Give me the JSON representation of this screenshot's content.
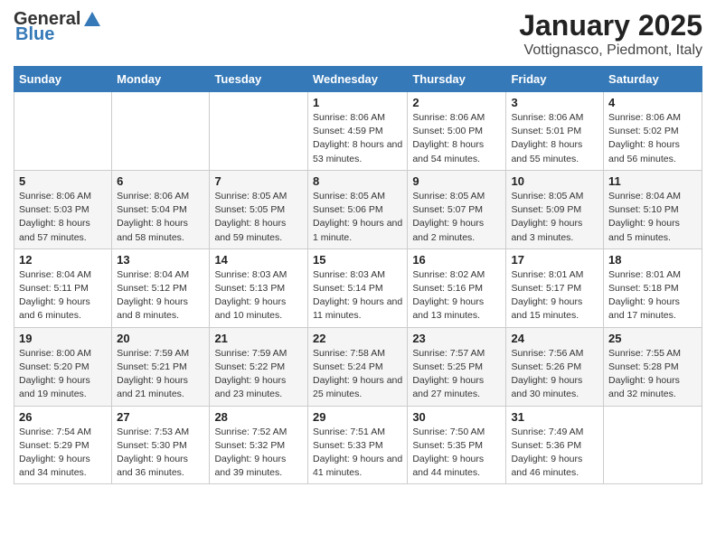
{
  "header": {
    "logo_general": "General",
    "logo_blue": "Blue",
    "title": "January 2025",
    "subtitle": "Vottignasco, Piedmont, Italy"
  },
  "columns": [
    "Sunday",
    "Monday",
    "Tuesday",
    "Wednesday",
    "Thursday",
    "Friday",
    "Saturday"
  ],
  "weeks": [
    [
      {
        "day": "",
        "info": ""
      },
      {
        "day": "",
        "info": ""
      },
      {
        "day": "",
        "info": ""
      },
      {
        "day": "1",
        "info": "Sunrise: 8:06 AM\nSunset: 4:59 PM\nDaylight: 8 hours and 53 minutes."
      },
      {
        "day": "2",
        "info": "Sunrise: 8:06 AM\nSunset: 5:00 PM\nDaylight: 8 hours and 54 minutes."
      },
      {
        "day": "3",
        "info": "Sunrise: 8:06 AM\nSunset: 5:01 PM\nDaylight: 8 hours and 55 minutes."
      },
      {
        "day": "4",
        "info": "Sunrise: 8:06 AM\nSunset: 5:02 PM\nDaylight: 8 hours and 56 minutes."
      }
    ],
    [
      {
        "day": "5",
        "info": "Sunrise: 8:06 AM\nSunset: 5:03 PM\nDaylight: 8 hours and 57 minutes."
      },
      {
        "day": "6",
        "info": "Sunrise: 8:06 AM\nSunset: 5:04 PM\nDaylight: 8 hours and 58 minutes."
      },
      {
        "day": "7",
        "info": "Sunrise: 8:05 AM\nSunset: 5:05 PM\nDaylight: 8 hours and 59 minutes."
      },
      {
        "day": "8",
        "info": "Sunrise: 8:05 AM\nSunset: 5:06 PM\nDaylight: 9 hours and 1 minute."
      },
      {
        "day": "9",
        "info": "Sunrise: 8:05 AM\nSunset: 5:07 PM\nDaylight: 9 hours and 2 minutes."
      },
      {
        "day": "10",
        "info": "Sunrise: 8:05 AM\nSunset: 5:09 PM\nDaylight: 9 hours and 3 minutes."
      },
      {
        "day": "11",
        "info": "Sunrise: 8:04 AM\nSunset: 5:10 PM\nDaylight: 9 hours and 5 minutes."
      }
    ],
    [
      {
        "day": "12",
        "info": "Sunrise: 8:04 AM\nSunset: 5:11 PM\nDaylight: 9 hours and 6 minutes."
      },
      {
        "day": "13",
        "info": "Sunrise: 8:04 AM\nSunset: 5:12 PM\nDaylight: 9 hours and 8 minutes."
      },
      {
        "day": "14",
        "info": "Sunrise: 8:03 AM\nSunset: 5:13 PM\nDaylight: 9 hours and 10 minutes."
      },
      {
        "day": "15",
        "info": "Sunrise: 8:03 AM\nSunset: 5:14 PM\nDaylight: 9 hours and 11 minutes."
      },
      {
        "day": "16",
        "info": "Sunrise: 8:02 AM\nSunset: 5:16 PM\nDaylight: 9 hours and 13 minutes."
      },
      {
        "day": "17",
        "info": "Sunrise: 8:01 AM\nSunset: 5:17 PM\nDaylight: 9 hours and 15 minutes."
      },
      {
        "day": "18",
        "info": "Sunrise: 8:01 AM\nSunset: 5:18 PM\nDaylight: 9 hours and 17 minutes."
      }
    ],
    [
      {
        "day": "19",
        "info": "Sunrise: 8:00 AM\nSunset: 5:20 PM\nDaylight: 9 hours and 19 minutes."
      },
      {
        "day": "20",
        "info": "Sunrise: 7:59 AM\nSunset: 5:21 PM\nDaylight: 9 hours and 21 minutes."
      },
      {
        "day": "21",
        "info": "Sunrise: 7:59 AM\nSunset: 5:22 PM\nDaylight: 9 hours and 23 minutes."
      },
      {
        "day": "22",
        "info": "Sunrise: 7:58 AM\nSunset: 5:24 PM\nDaylight: 9 hours and 25 minutes."
      },
      {
        "day": "23",
        "info": "Sunrise: 7:57 AM\nSunset: 5:25 PM\nDaylight: 9 hours and 27 minutes."
      },
      {
        "day": "24",
        "info": "Sunrise: 7:56 AM\nSunset: 5:26 PM\nDaylight: 9 hours and 30 minutes."
      },
      {
        "day": "25",
        "info": "Sunrise: 7:55 AM\nSunset: 5:28 PM\nDaylight: 9 hours and 32 minutes."
      }
    ],
    [
      {
        "day": "26",
        "info": "Sunrise: 7:54 AM\nSunset: 5:29 PM\nDaylight: 9 hours and 34 minutes."
      },
      {
        "day": "27",
        "info": "Sunrise: 7:53 AM\nSunset: 5:30 PM\nDaylight: 9 hours and 36 minutes."
      },
      {
        "day": "28",
        "info": "Sunrise: 7:52 AM\nSunset: 5:32 PM\nDaylight: 9 hours and 39 minutes."
      },
      {
        "day": "29",
        "info": "Sunrise: 7:51 AM\nSunset: 5:33 PM\nDaylight: 9 hours and 41 minutes."
      },
      {
        "day": "30",
        "info": "Sunrise: 7:50 AM\nSunset: 5:35 PM\nDaylight: 9 hours and 44 minutes."
      },
      {
        "day": "31",
        "info": "Sunrise: 7:49 AM\nSunset: 5:36 PM\nDaylight: 9 hours and 46 minutes."
      },
      {
        "day": "",
        "info": ""
      }
    ]
  ]
}
